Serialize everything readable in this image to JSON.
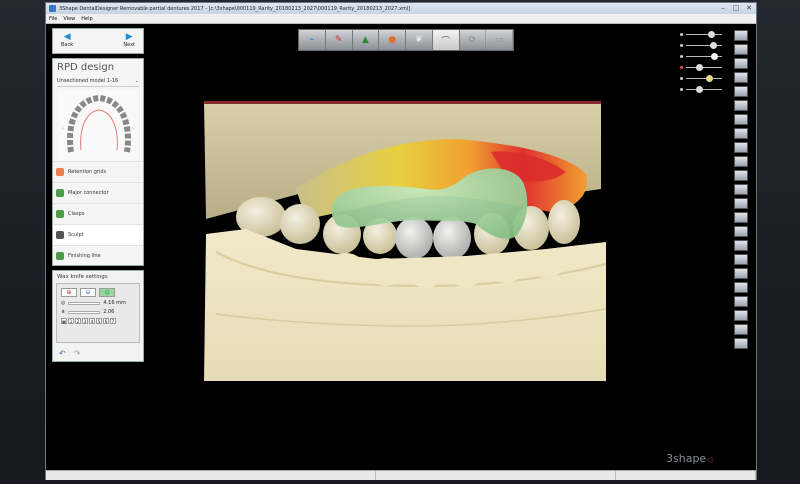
{
  "window": {
    "title": "3Shape DentalDesigner Removable partial dentures 2017 - [c:\\3shape\\000119_Rarity_20180213_2027\\000119_Rarity_20180213_2027.xml]",
    "minimize": "–",
    "maximize": "□",
    "close": "✕"
  },
  "menu": [
    "File",
    "View",
    "Help"
  ],
  "nav": {
    "back_label": "Back",
    "next_label": "Next",
    "back_icon": "arrow-left-icon",
    "next_icon": "arrow-right-icon"
  },
  "rpd": {
    "title": "RPD design",
    "model_select": "Unsectioned model 1-16",
    "steps": [
      {
        "label": "Retention grids",
        "icon": "retention-grid-icon",
        "color": "#e8824a"
      },
      {
        "label": "Major connector",
        "icon": "major-connector-icon",
        "color": "#4c9e4a"
      },
      {
        "label": "Clasps",
        "icon": "clasp-icon",
        "color": "#4c9e4a"
      },
      {
        "label": "Sculpt",
        "icon": "sculpt-icon",
        "color": "#555555"
      },
      {
        "label": "Finishing line",
        "icon": "finishing-line-icon",
        "color": "#4c9e4a"
      }
    ]
  },
  "wax": {
    "title": "Wax knife settings",
    "size_value": "4.16 mm",
    "strength_value": "2.06",
    "presets": [
      "1",
      "2",
      "3",
      "4",
      "5",
      "6",
      "7"
    ]
  },
  "toolbar_tabs": [
    {
      "icon": "scan-icon",
      "state": "normal"
    },
    {
      "icon": "survey-icon",
      "state": "normal"
    },
    {
      "icon": "block-out-icon",
      "state": "normal"
    },
    {
      "icon": "relief-icon",
      "state": "normal"
    },
    {
      "icon": "tooth-icon",
      "state": "normal"
    },
    {
      "icon": "rpd-design-icon",
      "state": "active"
    },
    {
      "icon": "save-icon",
      "state": "dim"
    },
    {
      "icon": "export-icon",
      "state": "dim"
    }
  ],
  "brand": {
    "logo_text": "3shape"
  },
  "colors": {
    "accent": "#1f8ecf",
    "wax": "#9dd19a",
    "model": "#e9dfb8",
    "teeth": "#c8c8c0"
  }
}
